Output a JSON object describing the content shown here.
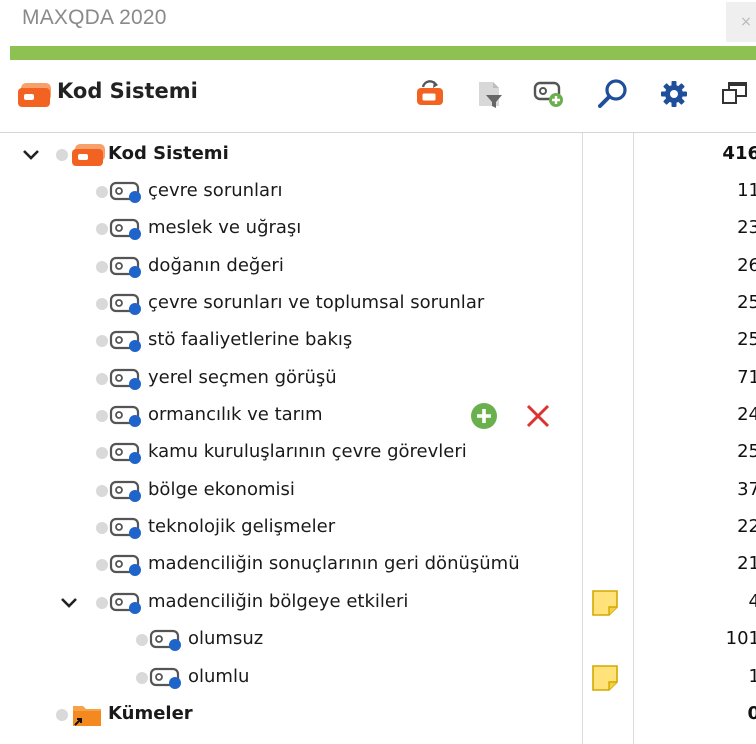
{
  "app": {
    "title": "MAXQDA 2020",
    "close_glyph": "×"
  },
  "header": {
    "title": "Kod Sistemi"
  },
  "toolbar": {
    "icons": [
      "code-system-restore-icon",
      "filter-document-icon",
      "new-code-icon",
      "search-icon",
      "settings-gear-icon",
      "undock-window-icon"
    ]
  },
  "colors": {
    "accent_green": "#8dc152",
    "code_orange": "#f26322",
    "code_blue": "#1f64c8",
    "memo_yellow": "#ffe27a",
    "add_green": "#6ab04c",
    "delete_red": "#e03131"
  },
  "tree": {
    "root": {
      "label": "Kod Sistemi",
      "count": "416"
    },
    "items": [
      {
        "label": "çevre sorunları",
        "count": "11"
      },
      {
        "label": "meslek ve uğraşı",
        "count": "23"
      },
      {
        "label": "doğanın değeri",
        "count": "26"
      },
      {
        "label": "çevre sorunları ve toplumsal sorunlar",
        "count": "25"
      },
      {
        "label": "stö faaliyetlerine bakış",
        "count": "25"
      },
      {
        "label": "yerel seçmen görüşü",
        "count": "71"
      },
      {
        "label": "ormancılık ve tarım",
        "count": "24"
      },
      {
        "label": "kamu kuruluşlarının çevre görevleri",
        "count": "25"
      },
      {
        "label": "bölge ekonomisi",
        "count": "37"
      },
      {
        "label": "teknolojik gelişmeler",
        "count": "22"
      },
      {
        "label": "madenciliğin sonuçlarının geri dönüşümü",
        "count": "21"
      },
      {
        "label": "madenciliğin bölgeye etkileri",
        "count": "4"
      }
    ],
    "children": [
      {
        "label": "olumsuz",
        "count": "101"
      },
      {
        "label": "olumlu",
        "count": "1"
      }
    ],
    "sets": {
      "label": "Kümeler",
      "count": "0"
    }
  }
}
